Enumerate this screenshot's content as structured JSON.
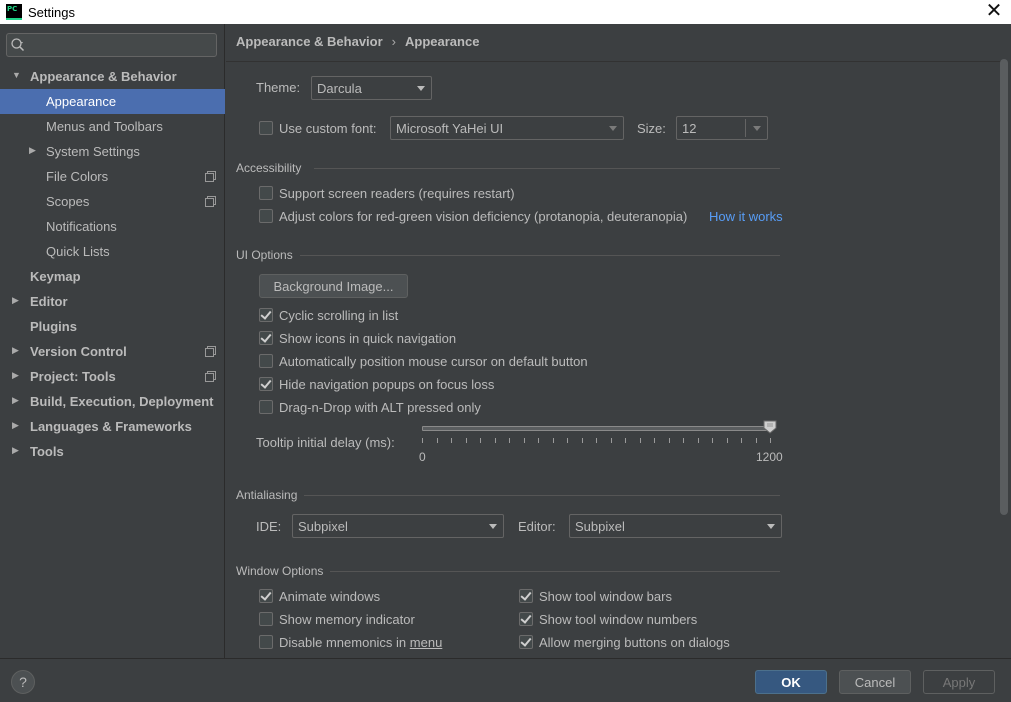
{
  "window": {
    "title": "Settings",
    "logo_text": "PC"
  },
  "search": {
    "placeholder": "",
    "value": ""
  },
  "sidebar": {
    "items": [
      {
        "label": "Appearance & Behavior",
        "bold": true,
        "expanded": true
      },
      {
        "label": "Appearance",
        "selected": true
      },
      {
        "label": "Menus and Toolbars"
      },
      {
        "label": "System Settings",
        "has_children": true
      },
      {
        "label": "File Colors",
        "project_icon": true
      },
      {
        "label": "Scopes",
        "project_icon": true
      },
      {
        "label": "Notifications"
      },
      {
        "label": "Quick Lists"
      },
      {
        "label": "Keymap",
        "bold": true
      },
      {
        "label": "Editor",
        "bold": true,
        "has_children": true
      },
      {
        "label": "Plugins",
        "bold": true
      },
      {
        "label": "Version Control",
        "bold": true,
        "has_children": true,
        "project_icon": true
      },
      {
        "label": "Project: Tools",
        "bold": true,
        "has_children": true,
        "project_icon": true
      },
      {
        "label": "Build, Execution, Deployment",
        "bold": true,
        "has_children": true
      },
      {
        "label": "Languages & Frameworks",
        "bold": true,
        "has_children": true
      },
      {
        "label": "Tools",
        "bold": true,
        "has_children": true
      }
    ]
  },
  "breadcrumb": {
    "parent": "Appearance & Behavior",
    "separator": "›",
    "current": "Appearance"
  },
  "theme": {
    "label": "Theme:",
    "value": "Darcula"
  },
  "font": {
    "checkbox_label": "Use custom font:",
    "checked": false,
    "value": "Microsoft YaHei UI",
    "size_label": "Size:",
    "size_value": "12"
  },
  "accessibility": {
    "title": "Accessibility",
    "screen_readers": {
      "label": "Support screen readers (requires restart)",
      "checked": false
    },
    "color_adjust": {
      "label": "Adjust colors for red-green vision deficiency (protanopia, deuteranopia)",
      "checked": false
    },
    "how_link": "How it works"
  },
  "ui_options": {
    "title": "UI Options",
    "bg_button": "Background Image...",
    "options": [
      {
        "label": "Cyclic scrolling in list",
        "checked": true
      },
      {
        "label": "Show icons in quick navigation",
        "checked": true
      },
      {
        "label": "Automatically position mouse cursor on default button",
        "checked": false
      },
      {
        "label": "Hide navigation popups on focus loss",
        "checked": true
      },
      {
        "label": "Drag-n-Drop with ALT pressed only",
        "checked": false
      }
    ],
    "tooltip": {
      "label": "Tooltip initial delay (ms):",
      "min": "0",
      "max": "1200",
      "value": 1200,
      "value_fraction": 1.0
    }
  },
  "antialiasing": {
    "title": "Antialiasing",
    "ide_label": "IDE:",
    "ide_value": "Subpixel",
    "editor_label": "Editor:",
    "editor_value": "Subpixel"
  },
  "window_options": {
    "title": "Window Options",
    "left": [
      {
        "label": "Animate windows",
        "checked": true
      },
      {
        "label": "Show memory indicator",
        "checked": false
      },
      {
        "label": "Disable mnemonics in ",
        "label_underlined": "menu",
        "checked": false
      }
    ],
    "right": [
      {
        "label": "Show tool window bars",
        "checked": true
      },
      {
        "label": "Show tool window numbers",
        "checked": true
      },
      {
        "label": "Allow merging buttons on dialogs",
        "checked": true
      }
    ]
  },
  "buttons": {
    "help": "?",
    "ok": "OK",
    "cancel": "Cancel",
    "apply": "Apply"
  },
  "colors": {
    "background": "#3c3f41",
    "selection": "#4b6eaf",
    "link": "#589df6",
    "primary_button": "#365880"
  }
}
